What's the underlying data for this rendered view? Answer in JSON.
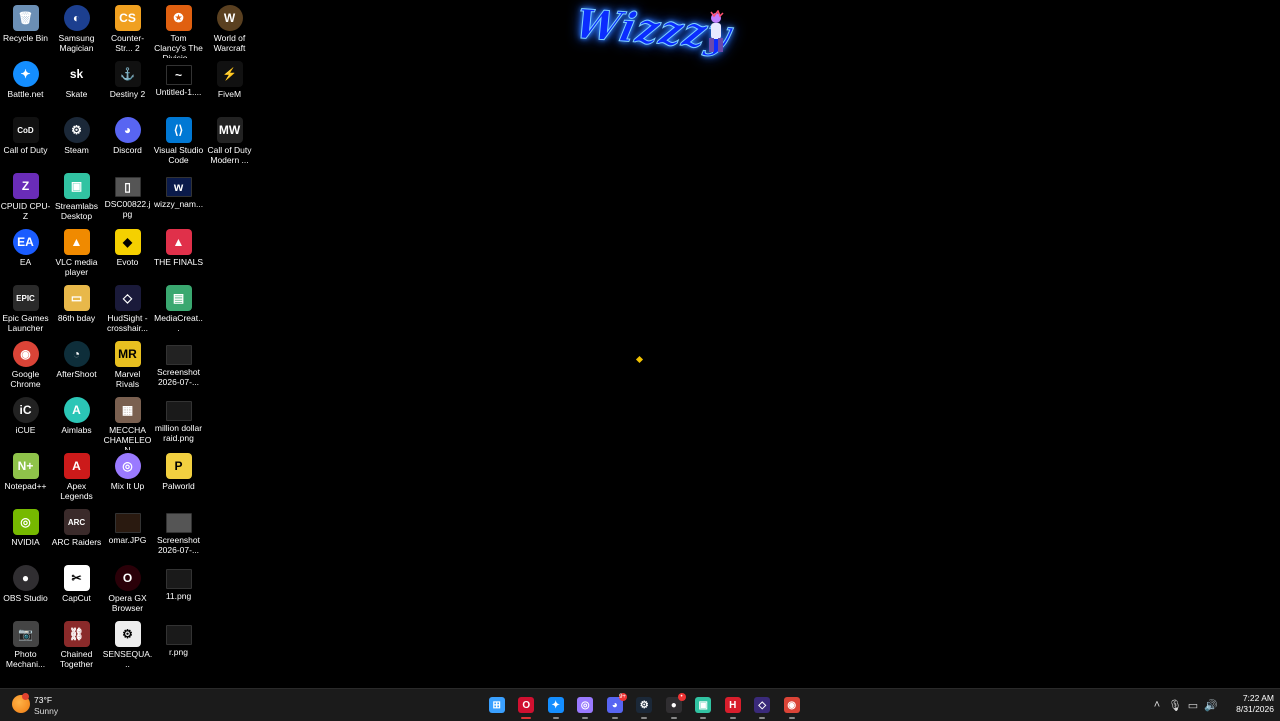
{
  "desktop": {
    "columns": [
      [
        {
          "label": "Recycle Bin",
          "icon": "recycle-bin-icon",
          "color": "#6b8fb5",
          "glyph": "🗑"
        },
        {
          "label": "Battle.net",
          "icon": "battlenet-icon",
          "color": "#148eff",
          "glyph": "✦",
          "round": true
        },
        {
          "label": "Call of Duty",
          "icon": "call-of-duty-icon",
          "color": "#111111",
          "glyph": "CoD"
        },
        {
          "label": "CPUID CPU-Z",
          "icon": "cpuz-icon",
          "color": "#6a2cb8",
          "glyph": "Z"
        },
        {
          "label": "EA",
          "icon": "ea-icon",
          "color": "#1a5cff",
          "glyph": "EA",
          "round": true
        },
        {
          "label": "Epic Games Launcher",
          "icon": "epic-games-icon",
          "color": "#2a2a2a",
          "glyph": "EPIC"
        },
        {
          "label": "Google Chrome",
          "icon": "chrome-icon",
          "color": "#db4437",
          "glyph": "◉",
          "round": true
        },
        {
          "label": "iCUE",
          "icon": "icue-icon",
          "color": "#222222",
          "glyph": "iC",
          "round": true
        },
        {
          "label": "Notepad++",
          "icon": "notepadpp-icon",
          "color": "#8fc34a",
          "glyph": "N+"
        },
        {
          "label": "NVIDIA",
          "icon": "nvidia-icon",
          "color": "#76b900",
          "glyph": "◎"
        },
        {
          "label": "OBS Studio",
          "icon": "obs-icon",
          "color": "#302e31",
          "glyph": "●",
          "round": true
        },
        {
          "label": "Photo Mechani...",
          "icon": "photo-mechanic-icon",
          "color": "#444444",
          "glyph": "📷"
        }
      ],
      [
        {
          "label": "Samsung Magician",
          "icon": "samsung-magician-icon",
          "color": "#1c3f8f",
          "glyph": "◐",
          "round": true
        },
        {
          "label": "Skate",
          "icon": "skate-icon",
          "color": "#000000",
          "glyph": "sk"
        },
        {
          "label": "Steam",
          "icon": "steam-icon",
          "color": "#1b2838",
          "glyph": "⚙",
          "round": true
        },
        {
          "label": "Streamlabs Desktop",
          "icon": "streamlabs-icon",
          "color": "#31c3a2",
          "glyph": "▣"
        },
        {
          "label": "VLC media player",
          "icon": "vlc-icon",
          "color": "#f08a00",
          "glyph": "▲"
        },
        {
          "label": "86th bday",
          "icon": "folder-icon",
          "color": "#e8b84a",
          "glyph": "▭"
        },
        {
          "label": "AfterShoot",
          "icon": "aftershoot-icon",
          "color": "#0e2e3a",
          "glyph": "◔",
          "round": true
        },
        {
          "label": "Aimlabs",
          "icon": "aimlabs-icon",
          "color": "#2bc6b6",
          "glyph": "A",
          "round": true
        },
        {
          "label": "Apex Legends",
          "icon": "apex-legends-icon",
          "color": "#cc1a1a",
          "glyph": "A"
        },
        {
          "label": "ARC Raiders",
          "icon": "arc-raiders-icon",
          "color": "#3a2a2a",
          "glyph": "ARC"
        },
        {
          "label": "CapCut",
          "icon": "capcut-icon",
          "color": "#ffffff",
          "glyph": "✂"
        },
        {
          "label": "Chained Together",
          "icon": "chained-together-icon",
          "color": "#8a2a2a",
          "glyph": "⛓"
        }
      ],
      [
        {
          "label": "Counter-Str... 2",
          "icon": "counter-strike-icon",
          "color": "#f0a020",
          "glyph": "CS"
        },
        {
          "label": "Destiny 2",
          "icon": "destiny-icon",
          "color": "#111111",
          "glyph": "⚓"
        },
        {
          "label": "Discord",
          "icon": "discord-icon",
          "color": "#5865f2",
          "glyph": "◕",
          "round": true
        },
        {
          "label": "DSC00822.jpg",
          "icon": "image-file-icon",
          "color": "#555555",
          "glyph": "▯",
          "thumb": true
        },
        {
          "label": "Evoto",
          "icon": "evoto-icon",
          "color": "#f5d000",
          "glyph": "◆"
        },
        {
          "label": "HudSight - crosshair...",
          "icon": "hudsight-icon",
          "color": "#1a1a3a",
          "glyph": "◇"
        },
        {
          "label": "Marvel Rivals",
          "icon": "marvel-rivals-icon",
          "color": "#e8c020",
          "glyph": "MR"
        },
        {
          "label": "MECCHA CHAMELEON",
          "icon": "meccha-chameleon-icon",
          "color": "#7a6050",
          "glyph": "▦"
        },
        {
          "label": "Mix It Up",
          "icon": "mix-it-up-icon",
          "color": "#9a7aff",
          "glyph": "◎",
          "round": true
        },
        {
          "label": "omar.JPG",
          "icon": "image-file-icon",
          "color": "#2a1a10",
          "glyph": "",
          "thumb": true
        },
        {
          "label": "Opera GX Browser",
          "icon": "opera-gx-icon",
          "color": "#2a0008",
          "glyph": "O",
          "round": true
        },
        {
          "label": "SENSEQUA...",
          "icon": "sensequal-icon",
          "color": "#eeeeee",
          "glyph": "⚙"
        }
      ],
      [
        {
          "label": "Tom Clancy's The Divisio...",
          "icon": "division-icon",
          "color": "#e06010",
          "glyph": "✪"
        },
        {
          "label": "Untitled-1....",
          "icon": "image-file-icon",
          "color": "#000000",
          "glyph": "~",
          "thumb": true
        },
        {
          "label": "Visual Studio Code",
          "icon": "vscode-icon",
          "color": "#0078d4",
          "glyph": "⟨⟩"
        },
        {
          "label": "wizzy_nam...",
          "icon": "image-file-icon",
          "color": "#0a1a4a",
          "glyph": "w",
          "thumb": true
        },
        {
          "label": "THE FINALS",
          "icon": "the-finals-icon",
          "color": "#e0304a",
          "glyph": "▲"
        },
        {
          "label": "MediaCreat...",
          "icon": "media-creation-icon",
          "color": "#3aa870",
          "glyph": "▤"
        },
        {
          "label": "Screenshot 2026-07-...",
          "icon": "image-file-icon",
          "color": "#222222",
          "glyph": "",
          "thumb": true
        },
        {
          "label": "million dollar raid.png",
          "icon": "image-file-icon",
          "color": "#1a1a1a",
          "glyph": "",
          "thumb": true
        },
        {
          "label": "Palworld",
          "icon": "palworld-icon",
          "color": "#f2d040",
          "glyph": "P"
        },
        {
          "label": "Screenshot 2026-07-...",
          "icon": "image-file-icon",
          "color": "#555555",
          "glyph": "",
          "thumb": true
        },
        {
          "label": "11.png",
          "icon": "image-file-icon",
          "color": "#1a1a1a",
          "glyph": "",
          "thumb": true
        },
        {
          "label": "r.png",
          "icon": "image-file-icon",
          "color": "#1a1a1a",
          "glyph": "",
          "thumb": true
        }
      ],
      [
        {
          "label": "World of Warcraft",
          "icon": "wow-icon",
          "color": "#5a4020",
          "glyph": "W",
          "round": true
        },
        {
          "label": "FiveM",
          "icon": "fivem-icon",
          "color": "#111111",
          "glyph": "⚡"
        },
        {
          "label": "Call of Duty Modern ...",
          "icon": "cod-modern-warfare-icon",
          "color": "#222222",
          "glyph": "MW"
        }
      ]
    ]
  },
  "wallpaper": {
    "logo_text": "Wizzzy"
  },
  "taskbar": {
    "weather": {
      "temp": "73°F",
      "condition": "Sunny"
    },
    "apps": [
      {
        "name": "start-button",
        "icon": "windows-start-icon",
        "color": "#3aa0ff",
        "glyph": "⊞"
      },
      {
        "name": "taskbar-opera-gx",
        "icon": "opera-gx-icon",
        "color": "#d01030",
        "glyph": "O",
        "active": true
      },
      {
        "name": "taskbar-battlenet",
        "icon": "battlenet-icon",
        "color": "#148eff",
        "glyph": "✦"
      },
      {
        "name": "taskbar-mix-it-up",
        "icon": "mix-it-up-icon",
        "color": "#9a7aff",
        "glyph": "◎"
      },
      {
        "name": "taskbar-discord",
        "icon": "discord-icon",
        "color": "#5865f2",
        "glyph": "◕",
        "badge": "9+"
      },
      {
        "name": "taskbar-steam",
        "icon": "steam-icon",
        "color": "#1b2838",
        "glyph": "⚙"
      },
      {
        "name": "taskbar-obs",
        "icon": "obs-icon",
        "color": "#302e31",
        "glyph": "●",
        "badge": "•"
      },
      {
        "name": "taskbar-streamlabs",
        "icon": "streamlabs-icon",
        "color": "#31c3a2",
        "glyph": "▣"
      },
      {
        "name": "taskbar-hyper",
        "icon": "h-app-icon",
        "color": "#d81e2c",
        "glyph": "H"
      },
      {
        "name": "taskbar-hudsight",
        "icon": "hudsight-icon",
        "color": "#3a2a7a",
        "glyph": "◇"
      },
      {
        "name": "taskbar-chrome",
        "icon": "chrome-icon",
        "color": "#db4437",
        "glyph": "◉"
      }
    ],
    "tray": [
      {
        "name": "show-hidden-icons-button",
        "icon": "chevron-up-icon",
        "glyph": "˄"
      },
      {
        "name": "microphone-tray",
        "icon": "microphone-icon",
        "glyph": "🎙"
      },
      {
        "name": "network-tray",
        "icon": "network-icon",
        "glyph": "▭"
      },
      {
        "name": "volume-tray",
        "icon": "volume-icon",
        "glyph": "🔊"
      }
    ],
    "clock": {
      "time": "7:22 AM",
      "date": "8/31/2026"
    }
  }
}
